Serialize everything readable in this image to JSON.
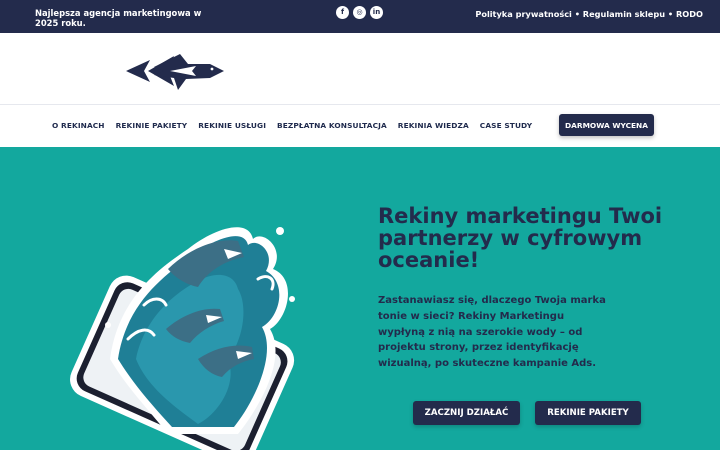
{
  "topbar": {
    "tagline": "Najlepsza agencja marketingowa w 2025 roku.",
    "socials": [
      {
        "icon": "facebook-icon",
        "glyph": "f"
      },
      {
        "icon": "instagram-icon",
        "glyph": "◎"
      },
      {
        "icon": "linkedin-icon",
        "glyph": "in"
      }
    ],
    "legal": "Polityka prywatności • Regulamin sklepu • RODO"
  },
  "nav": {
    "items": [
      "O REKINACH",
      "REKINIE PAKIETY",
      "REKINIE USŁUGI",
      "BEZPŁATNA KONSULTACJA",
      "REKINIA WIEDZA",
      "CASE STUDY"
    ],
    "cta": "DARMOWA WYCENA"
  },
  "hero": {
    "heading": "Rekiny marketingu Twoi partnerzy w cyfrowym oceanie!",
    "body": "Zastanawiasz się, dlaczego Twoja marka tonie w sieci? Rekiny Marketingu wypłyną z nią na szerokie wody – od projektu strony, przez identyfikację wizualną, po skuteczne kampanie Ads.",
    "primary_button": "ZACZNIJ DZIAŁAĆ",
    "secondary_button": "REKINIE PAKIETY"
  },
  "colors": {
    "navy": "#232b4c",
    "teal": "#13a89e"
  }
}
